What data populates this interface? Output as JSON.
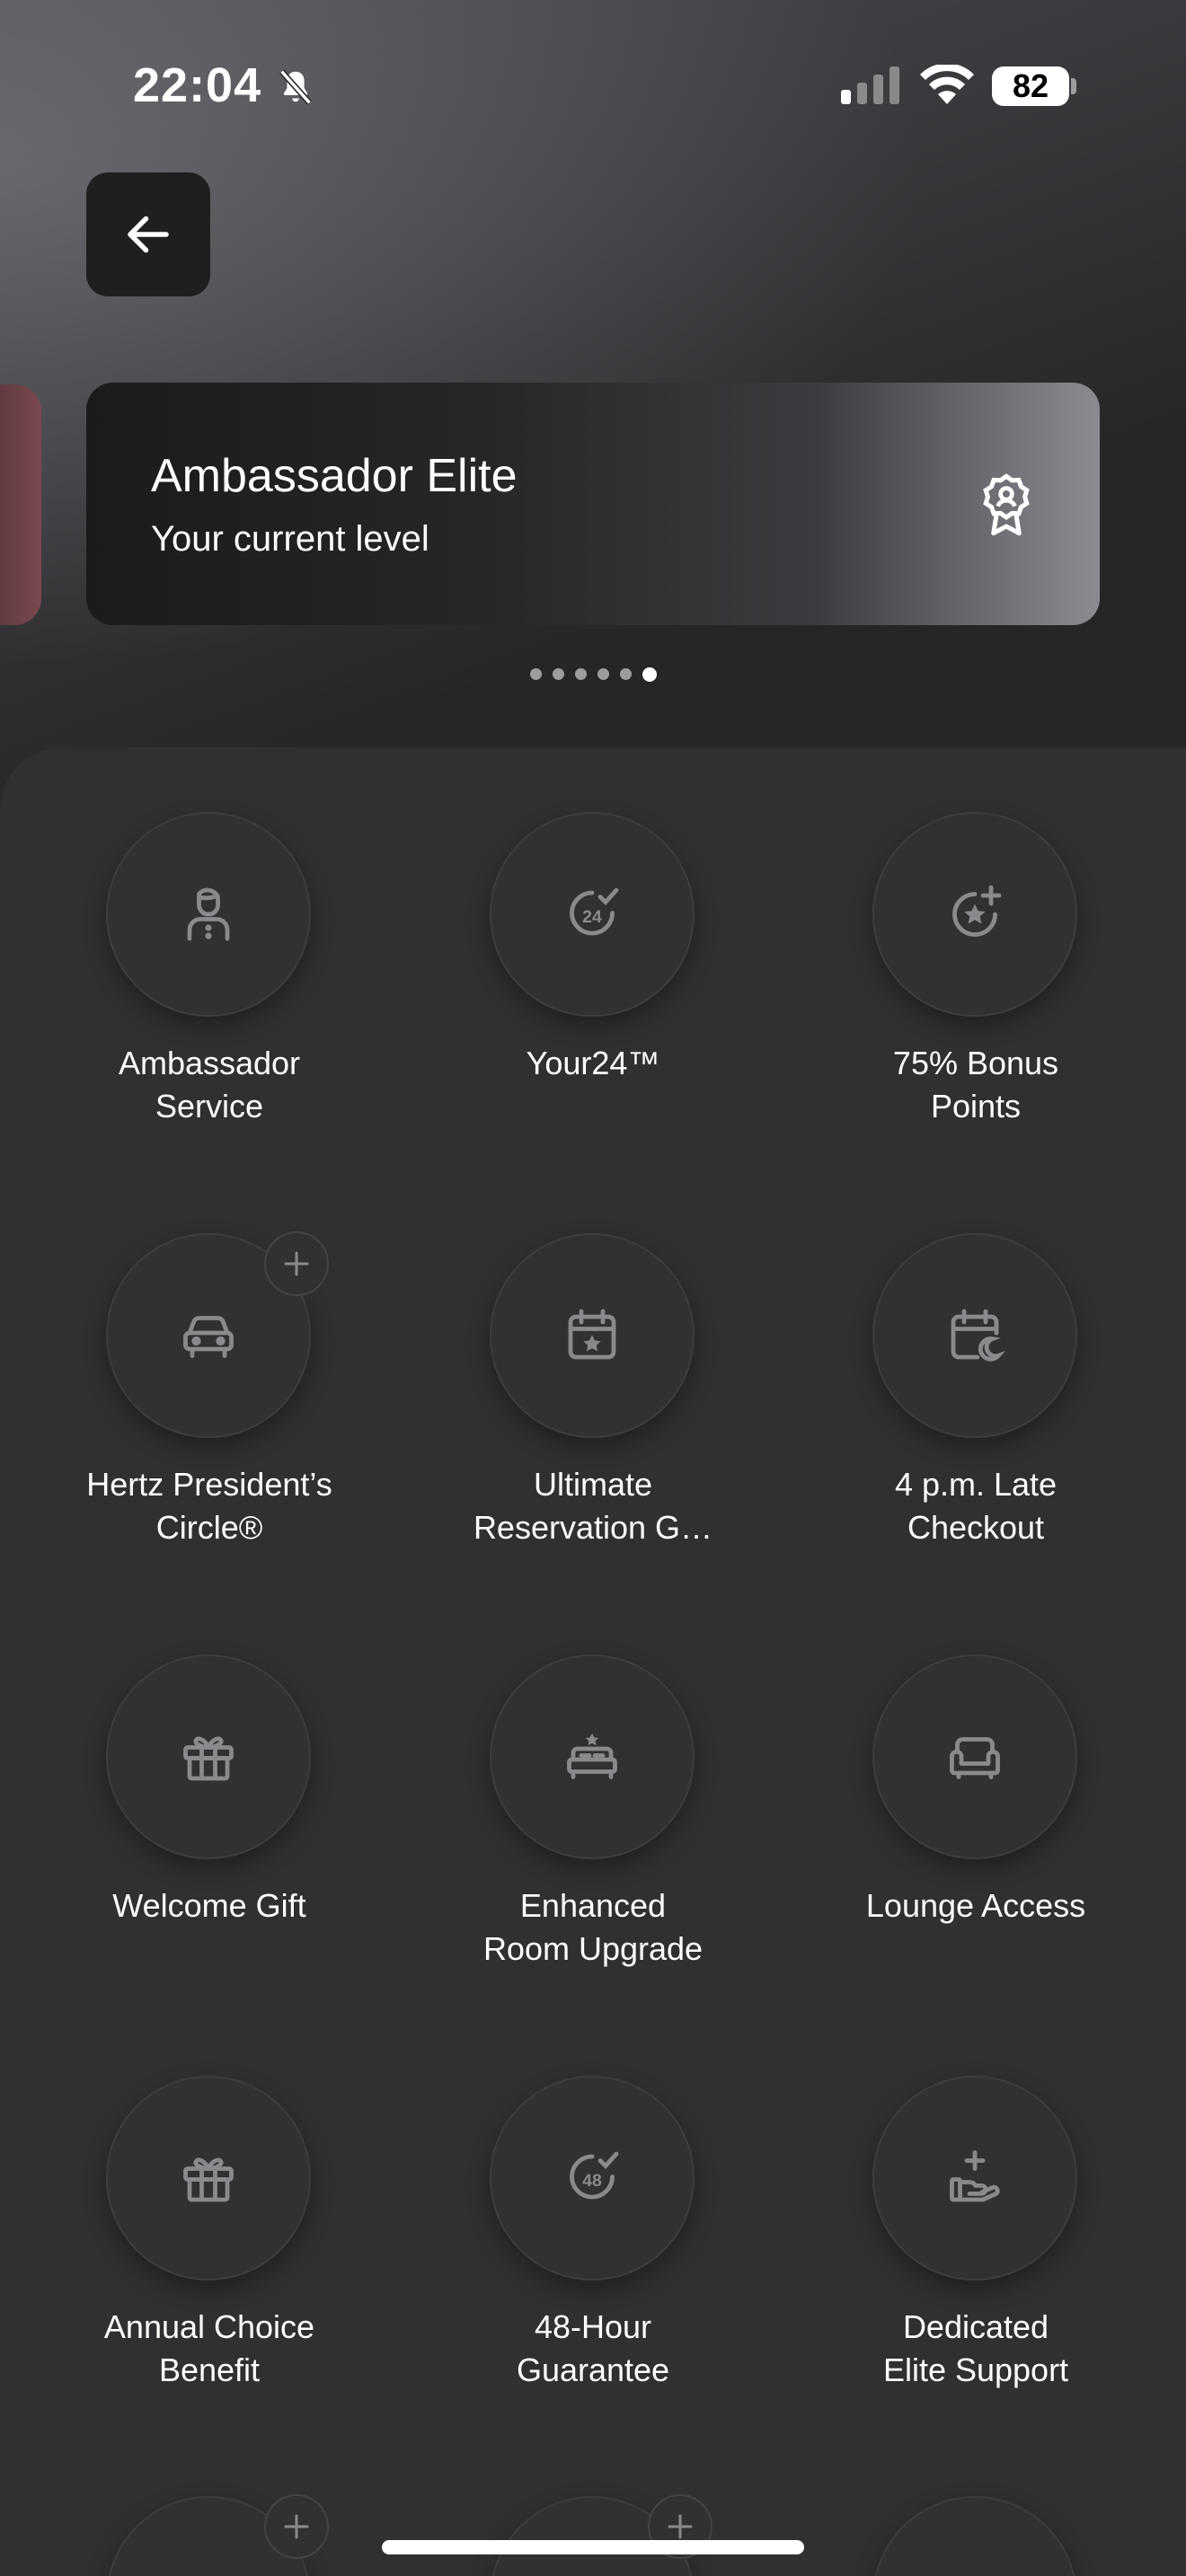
{
  "status_bar": {
    "time": "22:04",
    "battery": "82",
    "icons": [
      "bell-slash-icon",
      "cellular-signal-icon",
      "wifi-icon",
      "battery-icon"
    ]
  },
  "header": {
    "back_icon": "arrow-left-icon"
  },
  "level_card": {
    "title": "Ambassador Elite",
    "subtitle": "Your current level",
    "icon": "award-badge-icon"
  },
  "carousel": {
    "page_count": 6,
    "active_index": 5
  },
  "benefits": [
    {
      "label": "Ambassador\nService",
      "icon": "concierge-person-icon",
      "has_plus": false
    },
    {
      "label": "Your24™",
      "icon": "clock-24-check-icon",
      "has_plus": false
    },
    {
      "label": "75% Bonus\nPoints",
      "icon": "star-plus-icon",
      "has_plus": false
    },
    {
      "label": "Hertz President’s\nCircle®",
      "icon": "car-icon",
      "has_plus": true
    },
    {
      "label": "Ultimate\nReservation G…",
      "icon": "calendar-star-icon",
      "has_plus": false
    },
    {
      "label": "4 p.m. Late\nCheckout",
      "icon": "calendar-moon-icon",
      "has_plus": false
    },
    {
      "label": "Welcome Gift",
      "icon": "gift-icon",
      "has_plus": false
    },
    {
      "label": "Enhanced\nRoom Upgrade",
      "icon": "bed-star-icon",
      "has_plus": false
    },
    {
      "label": "Lounge Access",
      "icon": "sofa-icon",
      "has_plus": false
    },
    {
      "label": "Annual Choice\nBenefit",
      "icon": "gift-icon",
      "has_plus": false
    },
    {
      "label": "48-Hour\nGuarantee",
      "icon": "clock-48-check-icon",
      "has_plus": false
    },
    {
      "label": "Dedicated\nElite Support",
      "icon": "hand-plus-icon",
      "has_plus": false
    },
    {
      "label": "",
      "icon": "partial-icon",
      "has_plus": true
    },
    {
      "label": "",
      "icon": "partial-icon",
      "has_plus": true
    },
    {
      "label": "",
      "icon": "partial-icon",
      "has_plus": false
    }
  ],
  "colors": {
    "icon_gray": "#8a8a8e",
    "sheet_bg": "#303032",
    "card_dark": "#1b1b1d"
  }
}
